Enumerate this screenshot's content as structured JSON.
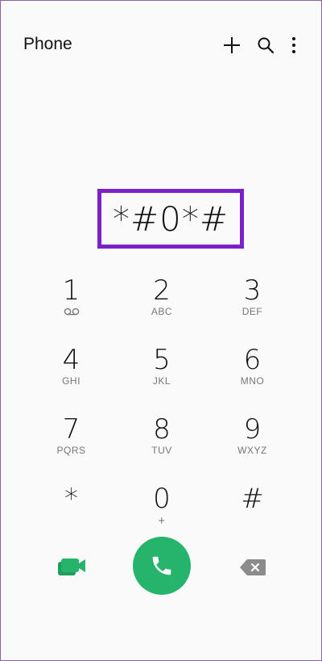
{
  "app": {
    "title": "Phone"
  },
  "toolbar": {
    "add_icon": "plus-icon",
    "search_icon": "search-icon",
    "menu_icon": "more-vert-icon"
  },
  "dialer": {
    "entered": "*#0*#"
  },
  "keypad": [
    {
      "digit": "1",
      "letters": "",
      "icon": "voicemail-icon"
    },
    {
      "digit": "2",
      "letters": "ABC"
    },
    {
      "digit": "3",
      "letters": "DEF"
    },
    {
      "digit": "4",
      "letters": "GHI"
    },
    {
      "digit": "5",
      "letters": "JKL"
    },
    {
      "digit": "6",
      "letters": "MNO"
    },
    {
      "digit": "7",
      "letters": "PQRS"
    },
    {
      "digit": "8",
      "letters": "TUV"
    },
    {
      "digit": "9",
      "letters": "WXYZ"
    },
    {
      "digit": "*",
      "letters": ""
    },
    {
      "digit": "0",
      "letters": "+"
    },
    {
      "digit": "#",
      "letters": ""
    }
  ],
  "actions": {
    "video_icon": "video-call-icon",
    "call_icon": "phone-call-icon",
    "delete_icon": "backspace-icon"
  },
  "colors": {
    "highlight": "#7a22c7",
    "call_green": "#26b36a",
    "video_green": "#1e9e5c",
    "delete_gray": "#8c8c8c"
  }
}
